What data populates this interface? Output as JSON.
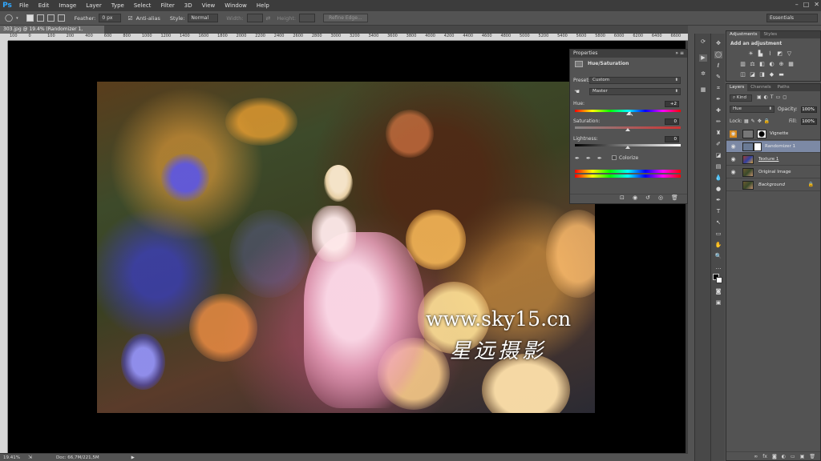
{
  "app": {
    "logo": "Ps"
  },
  "menu": [
    "File",
    "Edit",
    "Image",
    "Layer",
    "Type",
    "Select",
    "Filter",
    "3D",
    "View",
    "Window",
    "Help"
  ],
  "window_controls": [
    "–",
    "□",
    "✕"
  ],
  "options_bar": {
    "feather_label": "Feather:",
    "feather_value": "0 px",
    "antialias_label": "Anti-alias",
    "style_label": "Style:",
    "style_value": "Normal",
    "width_label": "Width:",
    "height_label": "Height:",
    "refine_edge": "Refine Edge...",
    "workspace": "Essentials"
  },
  "document": {
    "tab_title": "303.jpg @ 19.4% (Randomizer 1, RGB/8#) *",
    "ruler_ticks": [
      "100",
      "0",
      "100",
      "200",
      "400",
      "600",
      "800",
      "1000",
      "1200",
      "1400",
      "1600",
      "1800",
      "2000",
      "2200",
      "2400",
      "2600",
      "2800",
      "3000",
      "3200",
      "3400",
      "3600",
      "3800",
      "4000",
      "4200",
      "4400",
      "4600",
      "4800",
      "5000",
      "5200",
      "5400",
      "5600",
      "5800",
      "6000",
      "6200",
      "6400",
      "6600"
    ],
    "watermark_url": "www.sky15.cn",
    "watermark_cn": "星远摄影"
  },
  "status_bar": {
    "zoom": "19.41%",
    "doc": "Doc: 66,7M/221,5M"
  },
  "properties": {
    "title": "Properties",
    "panel_name": "Hue/Saturation",
    "preset_label": "Preset:",
    "preset_value": "Custom",
    "channel_value": "Master",
    "hue_label": "Hue:",
    "hue_value": "+2",
    "saturation_label": "Saturation:",
    "saturation_value": "0",
    "lightness_label": "Lightness:",
    "lightness_value": "0",
    "colorize_label": "Colorize"
  },
  "adjustments": {
    "tabs": [
      "Adjustments",
      "Styles"
    ],
    "add_label": "Add an adjustment"
  },
  "layers_panel": {
    "tabs": [
      "Layers",
      "Channels",
      "Paths"
    ],
    "kind_label": "Kind",
    "blend_mode": "Hue",
    "opacity_label": "Opacity:",
    "opacity_value": "100%",
    "lock_label": "Lock:",
    "fill_label": "Fill:",
    "fill_value": "100%",
    "layers": [
      {
        "name": "Vignette",
        "selected": false,
        "eye_orange": true
      },
      {
        "name": "Randomizer 1",
        "selected": true,
        "eye_orange": false
      },
      {
        "name": "Texture 1",
        "selected": false,
        "eye_orange": false
      },
      {
        "name": "Original Image",
        "selected": false,
        "eye_orange": false
      },
      {
        "name": "Background",
        "selected": false,
        "eye_orange": false
      }
    ]
  }
}
